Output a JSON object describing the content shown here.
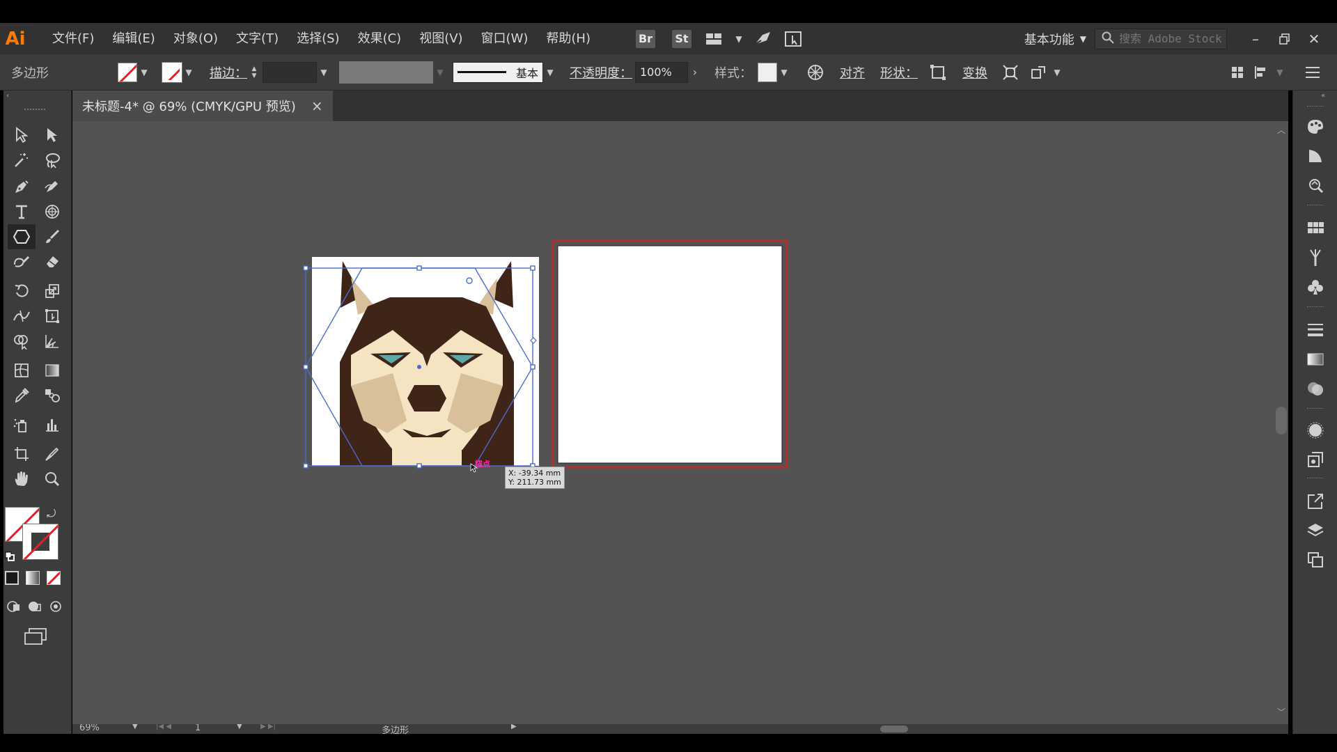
{
  "app": {
    "logo": "Ai"
  },
  "menu": {
    "items": [
      "文件(F)",
      "编辑(E)",
      "对象(O)",
      "文字(T)",
      "选择(S)",
      "效果(C)",
      "视图(V)",
      "窗口(W)",
      "帮助(H)"
    ],
    "bridge_badge": "Br",
    "stock_badge": "St",
    "workspace": "基本功能",
    "search_placeholder": "搜索 Adobe Stock"
  },
  "control": {
    "object_type": "多边形",
    "stroke_label": "描边：",
    "brush_label": "基本",
    "opacity_label": "不透明度：",
    "opacity_value": "100%",
    "style_label": "样式：",
    "align_label": "对齐",
    "shape_label": "形状：",
    "transform_label": "变换"
  },
  "document": {
    "tab_title": "未标题-4* @ 69% (CMYK/GPU 预览)",
    "close_glyph": "×"
  },
  "canvas": {
    "tooltip_x": "X: -39.34 mm",
    "tooltip_y": "Y: 211.73 mm",
    "anchor_label": "锚点"
  },
  "status": {
    "zoom": "69%",
    "artboard": "1",
    "status_text": "多边形"
  },
  "colors": {
    "dog_dark": "#3f2418",
    "dog_cream": "#f4e4c2",
    "dog_tan": "#d8c09a",
    "dog_eye": "#5fa8a8",
    "selection": "#4a6ccf",
    "artboard_border": "#b03030"
  }
}
